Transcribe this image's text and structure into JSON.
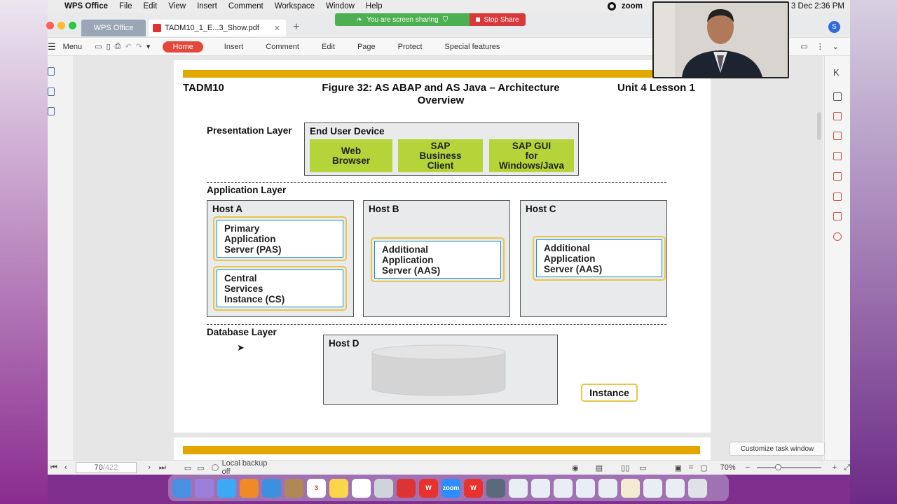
{
  "menubar": {
    "apple": "",
    "app": "WPS Office",
    "items": [
      "File",
      "Edit",
      "View",
      "Insert",
      "Comment",
      "Workspace",
      "Window",
      "Help"
    ],
    "zoom_label": "zoom",
    "datetime": "3 Dec  2:36 PM"
  },
  "share": {
    "status": "You are screen sharing",
    "stop": "Stop Share"
  },
  "tabs": {
    "wps": "WPS Office",
    "doc": "TADM10_1_E...3_Show.pdf",
    "add": "+",
    "avatar": "S"
  },
  "toolbar": {
    "menu": "Menu",
    "home": "Home",
    "items": [
      "Insert",
      "Comment",
      "Edit",
      "Page",
      "Protect",
      "Special features"
    ]
  },
  "figure": {
    "left_header": "TADM10",
    "title_line1": "Figure 32: AS ABAP and AS Java – Architecture",
    "title_line2": "Overview",
    "right_header": "Unit 4 Lesson 1",
    "presentation_layer": "Presentation Layer",
    "end_user_device": "End User Device",
    "clients": [
      "Web\nBrowser",
      "SAP\nBusiness\nClient",
      "SAP GUI\nfor\nWindows/Java"
    ],
    "application_layer": "Application Layer",
    "host_a": "Host A",
    "pas": "Primary\nApplication\nServer (PAS)",
    "cs": "Central\nServices\nInstance (CS)",
    "host_b": "Host B",
    "aas_b": "Additional\nApplication\nServer (AAS)",
    "host_c": "Host C",
    "aas_c": "Additional\nApplication\nServer (AAS)",
    "database_layer": "Database Layer",
    "host_d": "Host D",
    "instance": "Instance"
  },
  "statusbar": {
    "page_current": "70",
    "page_total": "/422",
    "backup": "Local backup off",
    "zoom": "70%"
  },
  "tooltip": "Customize task window",
  "colors": {
    "accent_red": "#e2483b",
    "gold": "#e3a800",
    "client_green": "#b4d43a",
    "server_border": "#1a8fc9"
  }
}
